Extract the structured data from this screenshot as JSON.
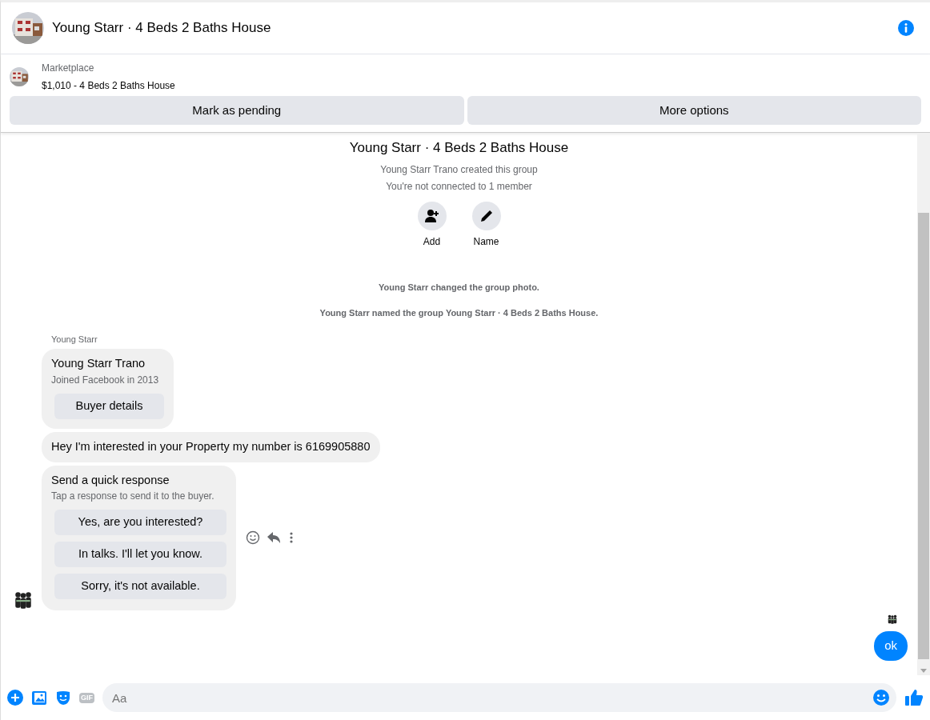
{
  "header": {
    "title": "Young Starr · 4 Beds 2 Baths House"
  },
  "listing": {
    "label": "Marketplace",
    "title": "$1,010 - 4 Beds 2 Baths House",
    "actions": [
      "Mark as pending",
      "More options"
    ]
  },
  "chat": {
    "group_title": "Young Starr · 4 Beds 2 Baths House",
    "info_lines": [
      "Young Starr Trano created this group",
      "You're not connected to 1 member"
    ],
    "group_actions": [
      {
        "kind": "add",
        "label": "Add"
      },
      {
        "kind": "name",
        "label": "Name"
      }
    ],
    "events": [
      "Young Starr changed the group photo.",
      "Young Starr named the group Young Starr · 4 Beds 2 Baths House."
    ],
    "sender": "Young Starr",
    "messages": [
      {
        "kind": "profile",
        "title": "Young Starr Trano",
        "subtitle": "Joined Facebook in 2013",
        "button": "Buyer details"
      },
      {
        "kind": "text",
        "text": "Hey I'm interested in your Property my number is 6169905880"
      },
      {
        "kind": "quick",
        "title": "Send a quick response",
        "subtitle": "Tap a response to send it to the buyer.",
        "options": [
          "Yes, are you interested?",
          "In talks. I'll let you know.",
          "Sorry, it's not available."
        ]
      }
    ],
    "outgoing": [
      {
        "text": "ok"
      }
    ]
  },
  "composer": {
    "gif": "GIF",
    "placeholder": "Aa"
  }
}
